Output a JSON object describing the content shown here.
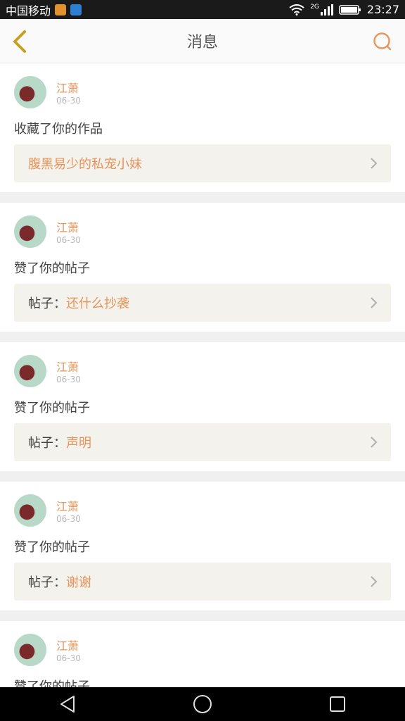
{
  "status_bar": {
    "carrier": "中国移动",
    "network": "2G",
    "time": "23:27"
  },
  "header": {
    "title": "消息",
    "back_icon": "chevron-left-icon",
    "search_icon": "search-icon"
  },
  "colors": {
    "accent": "#e8945a",
    "back_icon": "#c8a020",
    "text": "#444444",
    "card_ref_bg": "#f3f2ec"
  },
  "messages": [
    {
      "user": "江萧",
      "date": "06-30",
      "action": "收藏了你的作品",
      "ref_prefix": "",
      "ref_title": "腹黑易少的私宠小妹"
    },
    {
      "user": "江萧",
      "date": "06-30",
      "action": "赞了你的帖子",
      "ref_prefix": "帖子：",
      "ref_title": "还什么抄袭"
    },
    {
      "user": "江萧",
      "date": "06-30",
      "action": "赞了你的帖子",
      "ref_prefix": "帖子：",
      "ref_title": "声明"
    },
    {
      "user": "江萧",
      "date": "06-30",
      "action": "赞了你的帖子",
      "ref_prefix": "帖子：",
      "ref_title": "谢谢"
    },
    {
      "user": "江萧",
      "date": "06-30",
      "action": "赞了你的帖子",
      "ref_prefix": "",
      "ref_title": ""
    }
  ],
  "nav_bar": {
    "back_icon": "triangle-back-icon",
    "home_icon": "circle-home-icon",
    "recents_icon": "square-recents-icon"
  }
}
